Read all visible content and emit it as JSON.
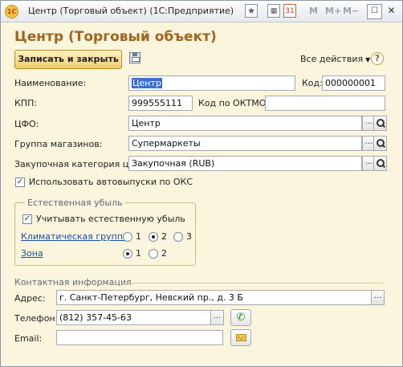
{
  "window": {
    "title": "Центр (Торговый объект)  (1С:Предприятие)",
    "logo_text": "1С",
    "toolbar_m": "M",
    "toolbar_m_plus": "M+",
    "toolbar_m_minus": "M−",
    "calendar_day": "31",
    "controls": {
      "minimize": "—",
      "maximize": "☐",
      "close": "✕"
    }
  },
  "form": {
    "title": "Центр (Торговый объект)",
    "save_close_label": "Записать и закрыть",
    "all_actions_label": "Все действия",
    "help_label": "?"
  },
  "fields": {
    "name_label": "Наименование:",
    "name_value": "Центр",
    "code_label": "Код:",
    "code_value": "000000001",
    "kpp_label": "КПП:",
    "kpp_value": "999555111",
    "oktmo_label": "Код по ОКТМО:",
    "oktmo_value": "",
    "cfo_label": "ЦФО:",
    "cfo_value": "Центр",
    "store_group_label": "Группа магазинов:",
    "store_group_value": "Супермаркеты",
    "price_category_label": "Закупочная категория цен:",
    "price_category_value": "Закупочная (RUB)",
    "autorelease_label": "Использовать автовыпуски по ОКС",
    "autorelease_checked": true
  },
  "natural_loss": {
    "title": "Естественная убыль",
    "consider_label": "Учитывать естественную убыль",
    "consider_checked": true,
    "climate_group_label": "Климатическая группа",
    "climate_options": [
      "1",
      "2",
      "3"
    ],
    "climate_selected": "2",
    "zone_label": "Зона",
    "zone_options": [
      "1",
      "2"
    ],
    "zone_selected": "1"
  },
  "contact": {
    "title": "Контактная информация",
    "address_label": "Адрес:",
    "address_value": "г. Санкт-Петербург, Невский пр., д. 3 Б",
    "phone_label": "Телефон:",
    "phone_value": "(812) 357-45-63",
    "email_label": "Email:",
    "email_value": ""
  },
  "common": {
    "ellipsis": "..."
  },
  "icons": {
    "app_logo": "onec-logo-icon",
    "save": "floppy-disk-icon",
    "search": "magnifier-icon",
    "phone": "phone-icon",
    "email": "envelope-icon"
  },
  "colors": {
    "title_accent": "#a0651d",
    "form_background": "#faf5dc",
    "primary_button": "#efcc6d",
    "link": "#1d4fa8"
  }
}
